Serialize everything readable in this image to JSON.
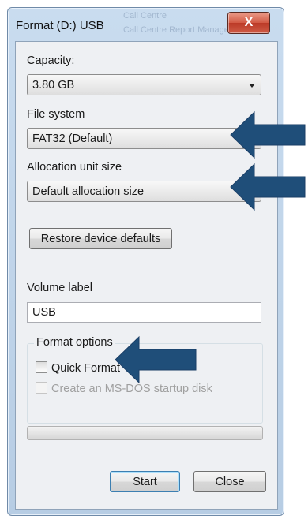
{
  "window": {
    "title": "Format (D:) USB",
    "close_glyph": "X",
    "background_ghost_lines": [
      "Call Centre",
      "Call Centre Report Manage"
    ]
  },
  "capacity": {
    "label": "Capacity:",
    "value": "3.80 GB"
  },
  "file_system": {
    "label": "File system",
    "value": "FAT32 (Default)"
  },
  "allocation": {
    "label": "Allocation unit size",
    "value": "Default allocation size"
  },
  "restore_button": "Restore device defaults",
  "volume": {
    "label": "Volume label",
    "value": "USB"
  },
  "format_options": {
    "title": "Format options",
    "quick_format": {
      "label": "Quick Format",
      "checked": false
    },
    "msdos_disk": {
      "label": "Create an MS-DOS startup disk",
      "checked": false,
      "enabled": false
    }
  },
  "progress": {
    "percent": 0
  },
  "buttons": {
    "start": "Start",
    "close": "Close"
  },
  "colors": {
    "annotation_arrow": "#1f4e79",
    "titlebar": "#c9dcef",
    "close_button": "#d25a44"
  },
  "icons": [
    "close-icon",
    "dropdown-arrow-icon",
    "annotation-arrow-icon"
  ]
}
